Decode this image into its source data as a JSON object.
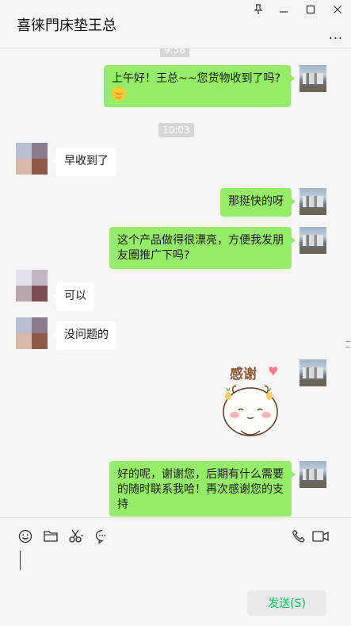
{
  "window": {
    "title": "喜徕門床垫王总",
    "controls": [
      "pin-icon",
      "minimize-icon",
      "maximize-icon",
      "close-icon"
    ],
    "more_label": "..."
  },
  "chat": {
    "timestamps": [
      "9:58",
      "10:03"
    ],
    "messages": [
      {
        "from": "me",
        "text": "上午好！王总~~您货物收到了吗?",
        "emoji": "smile-emoji"
      },
      {
        "from": "other",
        "text": "早收到了"
      },
      {
        "from": "me",
        "text": "那挺快的呀"
      },
      {
        "from": "me",
        "text": "这个产品做得很漂亮，方便我发朋友圈推广下吗?"
      },
      {
        "from": "other",
        "text": "可以"
      },
      {
        "from": "other",
        "text": "没问题的"
      },
      {
        "from": "me",
        "sticker": "thanks-sticker",
        "text": "感谢"
      },
      {
        "from": "me",
        "text": "好的呢，谢谢您，后期有什么需要的随时联系我哈！再次感谢您的支持"
      }
    ]
  },
  "toolbar": {
    "icons": [
      "emoji-icon",
      "folder-icon",
      "scissors-icon",
      "chat-history-icon",
      "phone-icon",
      "video-icon"
    ],
    "send_label": "发送(S)"
  },
  "colors": {
    "my_bubble": "#95ec69",
    "other_bubble": "#ffffff",
    "background": "#f5f5f5",
    "send_text": "#07c160"
  }
}
